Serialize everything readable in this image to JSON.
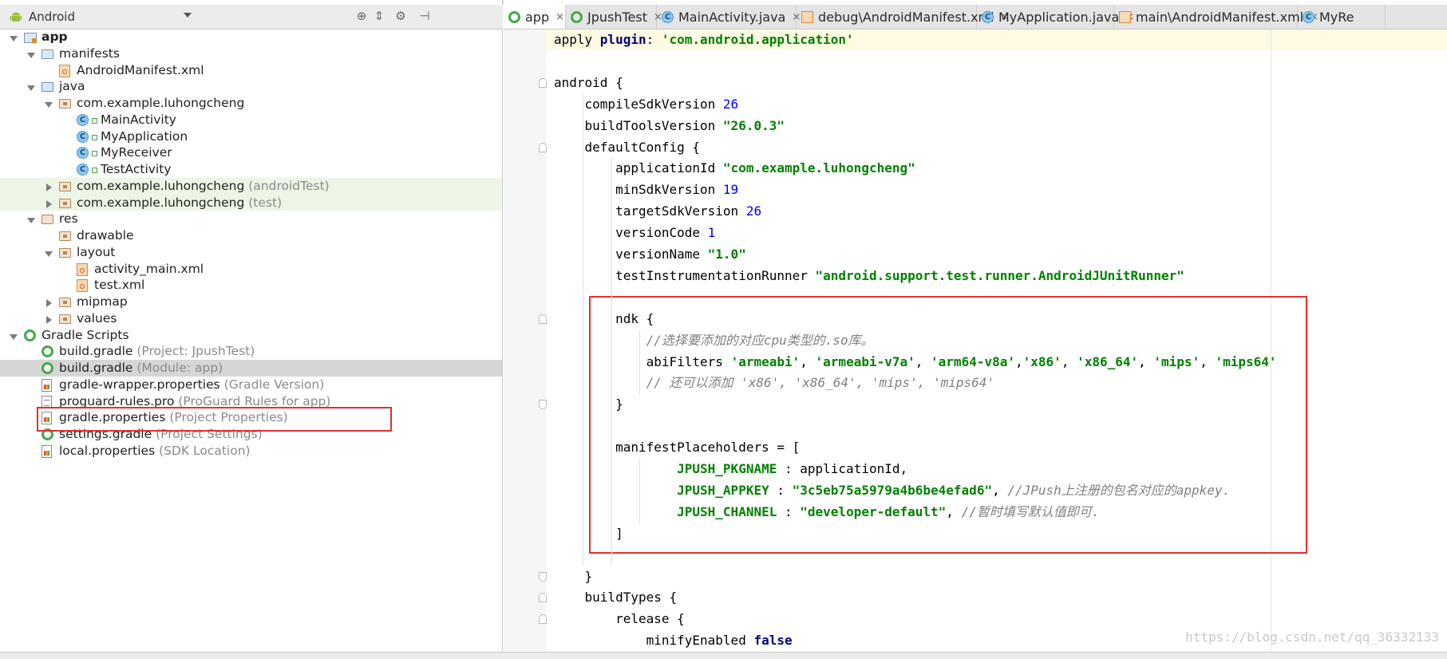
{
  "left_panel": {
    "scope": "Android",
    "tree": [
      {
        "label": "app",
        "hint": "",
        "depth": 0,
        "expanded": true,
        "icon": "app-module-icon",
        "bold": true
      },
      {
        "label": "manifests",
        "hint": "",
        "depth": 1,
        "expanded": true,
        "icon": "folder-icon"
      },
      {
        "label": "AndroidManifest.xml",
        "hint": "",
        "depth": 2,
        "icon": "xml-file-icon"
      },
      {
        "label": "java",
        "hint": "",
        "depth": 1,
        "expanded": true,
        "icon": "source-folder-icon"
      },
      {
        "label": "com.example.luhongcheng",
        "hint": "",
        "depth": 2,
        "expanded": true,
        "icon": "package-icon"
      },
      {
        "label": "MainActivity",
        "hint": "",
        "depth": 3,
        "icon": "java-class-icon"
      },
      {
        "label": "MyApplication",
        "hint": "",
        "depth": 3,
        "icon": "java-class-icon"
      },
      {
        "label": "MyReceiver",
        "hint": "",
        "depth": 3,
        "icon": "java-class-icon"
      },
      {
        "label": "TestActivity",
        "hint": "",
        "depth": 3,
        "icon": "java-class-icon"
      },
      {
        "label": "com.example.luhongcheng",
        "hint": "(androidTest)",
        "depth": 2,
        "expanded": false,
        "icon": "package-icon"
      },
      {
        "label": "com.example.luhongcheng",
        "hint": "(test)",
        "depth": 2,
        "expanded": false,
        "icon": "package-icon"
      },
      {
        "label": "res",
        "hint": "",
        "depth": 1,
        "expanded": true,
        "icon": "res-folder-icon"
      },
      {
        "label": "drawable",
        "hint": "",
        "depth": 2,
        "icon": "package-icon"
      },
      {
        "label": "layout",
        "hint": "",
        "depth": 2,
        "expanded": true,
        "icon": "package-icon"
      },
      {
        "label": "activity_main.xml",
        "hint": "",
        "depth": 3,
        "icon": "xml-file-icon"
      },
      {
        "label": "test.xml",
        "hint": "",
        "depth": 3,
        "icon": "xml-file-icon"
      },
      {
        "label": "mipmap",
        "hint": "",
        "depth": 2,
        "expanded": false,
        "icon": "package-icon"
      },
      {
        "label": "values",
        "hint": "",
        "depth": 2,
        "expanded": false,
        "icon": "package-icon"
      },
      {
        "label": "Gradle Scripts",
        "hint": "",
        "depth": 0,
        "expanded": true,
        "icon": "gradle-icon"
      },
      {
        "label": "build.gradle",
        "hint": "(Project: JpushTest)",
        "depth": 1,
        "icon": "gradle-icon"
      },
      {
        "label": "build.gradle",
        "hint": "(Module: app)",
        "depth": 1,
        "icon": "gradle-icon",
        "selected": true
      },
      {
        "label": "gradle-wrapper.properties",
        "hint": "(Gradle Version)",
        "depth": 1,
        "icon": "properties-file-icon"
      },
      {
        "label": "proguard-rules.pro",
        "hint": "(ProGuard Rules for app)",
        "depth": 1,
        "icon": "text-file-icon"
      },
      {
        "label": "gradle.properties",
        "hint": "(Project Properties)",
        "depth": 1,
        "icon": "properties-file-icon"
      },
      {
        "label": "settings.gradle",
        "hint": "(Project Settings)",
        "depth": 1,
        "icon": "gradle-icon"
      },
      {
        "label": "local.properties",
        "hint": "(SDK Location)",
        "depth": 1,
        "icon": "properties-file-icon"
      }
    ]
  },
  "editor": {
    "tabs": [
      {
        "label": "app",
        "icon": "gradle-icon",
        "active": true
      },
      {
        "label": "JpushTest",
        "icon": "gradle-icon"
      },
      {
        "label": "MainActivity.java",
        "icon": "java-class-icon"
      },
      {
        "label": "debug\\AndroidManifest.xml",
        "icon": "xml-file-icon"
      },
      {
        "label": "MyApplication.java",
        "icon": "java-class-icon"
      },
      {
        "label": "main\\AndroidManifest.xml",
        "icon": "xml-file-icon"
      },
      {
        "label": "MyRe",
        "icon": "java-class-icon"
      }
    ],
    "close_glyph": "×",
    "lines": [
      [
        {
          "t": "apply "
        },
        {
          "t": "plugin",
          "c": "kw"
        },
        {
          "t": ": "
        },
        {
          "t": "'com.android.application'",
          "c": "str"
        }
      ],
      [],
      [
        {
          "t": "android {"
        }
      ],
      [
        {
          "t": "    compileSdkVersion "
        },
        {
          "t": "26",
          "c": "num"
        }
      ],
      [
        {
          "t": "    buildToolsVersion "
        },
        {
          "t": "\"26.0.3\"",
          "c": "str"
        }
      ],
      [
        {
          "t": "    defaultConfig {"
        }
      ],
      [
        {
          "t": "        applicationId "
        },
        {
          "t": "\"com.example.luhongcheng\"",
          "c": "str"
        }
      ],
      [
        {
          "t": "        minSdkVersion "
        },
        {
          "t": "19",
          "c": "num"
        }
      ],
      [
        {
          "t": "        targetSdkVersion "
        },
        {
          "t": "26",
          "c": "num"
        }
      ],
      [
        {
          "t": "        versionCode "
        },
        {
          "t": "1",
          "c": "num"
        }
      ],
      [
        {
          "t": "        versionName "
        },
        {
          "t": "\"1.0\"",
          "c": "str"
        }
      ],
      [
        {
          "t": "        testInstrumentationRunner "
        },
        {
          "t": "\"android.support.test.runner.AndroidJUnitRunner\"",
          "c": "str"
        }
      ],
      [],
      [
        {
          "t": "        ndk {"
        }
      ],
      [
        {
          "t": "            "
        },
        {
          "t": "//选择要添加的对应cpu类型的.so库。",
          "c": "cmt"
        }
      ],
      [
        {
          "t": "            abiFilters "
        },
        {
          "t": "'armeabi'",
          "c": "str"
        },
        {
          "t": ", "
        },
        {
          "t": "'armeabi-v7a'",
          "c": "str"
        },
        {
          "t": ", "
        },
        {
          "t": "'arm64-v8a'",
          "c": "str"
        },
        {
          "t": ","
        },
        {
          "t": "'x86'",
          "c": "str"
        },
        {
          "t": ", "
        },
        {
          "t": "'x86_64'",
          "c": "str"
        },
        {
          "t": ", "
        },
        {
          "t": "'mips'",
          "c": "str"
        },
        {
          "t": ", "
        },
        {
          "t": "'mips64'",
          "c": "str"
        }
      ],
      [
        {
          "t": "            "
        },
        {
          "t": "// 还可以添加 'x86', 'x86_64', 'mips', 'mips64'",
          "c": "cmt"
        }
      ],
      [
        {
          "t": "        }"
        }
      ],
      [],
      [
        {
          "t": "        manifestPlaceholders = ["
        }
      ],
      [
        {
          "t": "                "
        },
        {
          "t": "JPUSH_PKGNAME",
          "c": "const"
        },
        {
          "t": " : applicationId,"
        }
      ],
      [
        {
          "t": "                "
        },
        {
          "t": "JPUSH_APPKEY",
          "c": "const"
        },
        {
          "t": " : "
        },
        {
          "t": "\"3c5eb75a5979a4b6be4efad6\"",
          "c": "str"
        },
        {
          "t": ", "
        },
        {
          "t": "//JPush上注册的包名对应的appkey.",
          "c": "cmt"
        }
      ],
      [
        {
          "t": "                "
        },
        {
          "t": "JPUSH_CHANNEL",
          "c": "const"
        },
        {
          "t": " : "
        },
        {
          "t": "\"developer-default\"",
          "c": "str"
        },
        {
          "t": ", "
        },
        {
          "t": "//暂时填写默认值即可.",
          "c": "cmt"
        }
      ],
      [
        {
          "t": "        ]"
        }
      ],
      [],
      [
        {
          "t": "    }"
        }
      ],
      [
        {
          "t": "    buildTypes {"
        }
      ],
      [
        {
          "t": "        release {"
        }
      ],
      [
        {
          "t": "            minifyEnabled "
        },
        {
          "t": "false",
          "c": "kwb"
        }
      ]
    ],
    "watermark": "https://blog.csdn.net/qq_36332133"
  }
}
